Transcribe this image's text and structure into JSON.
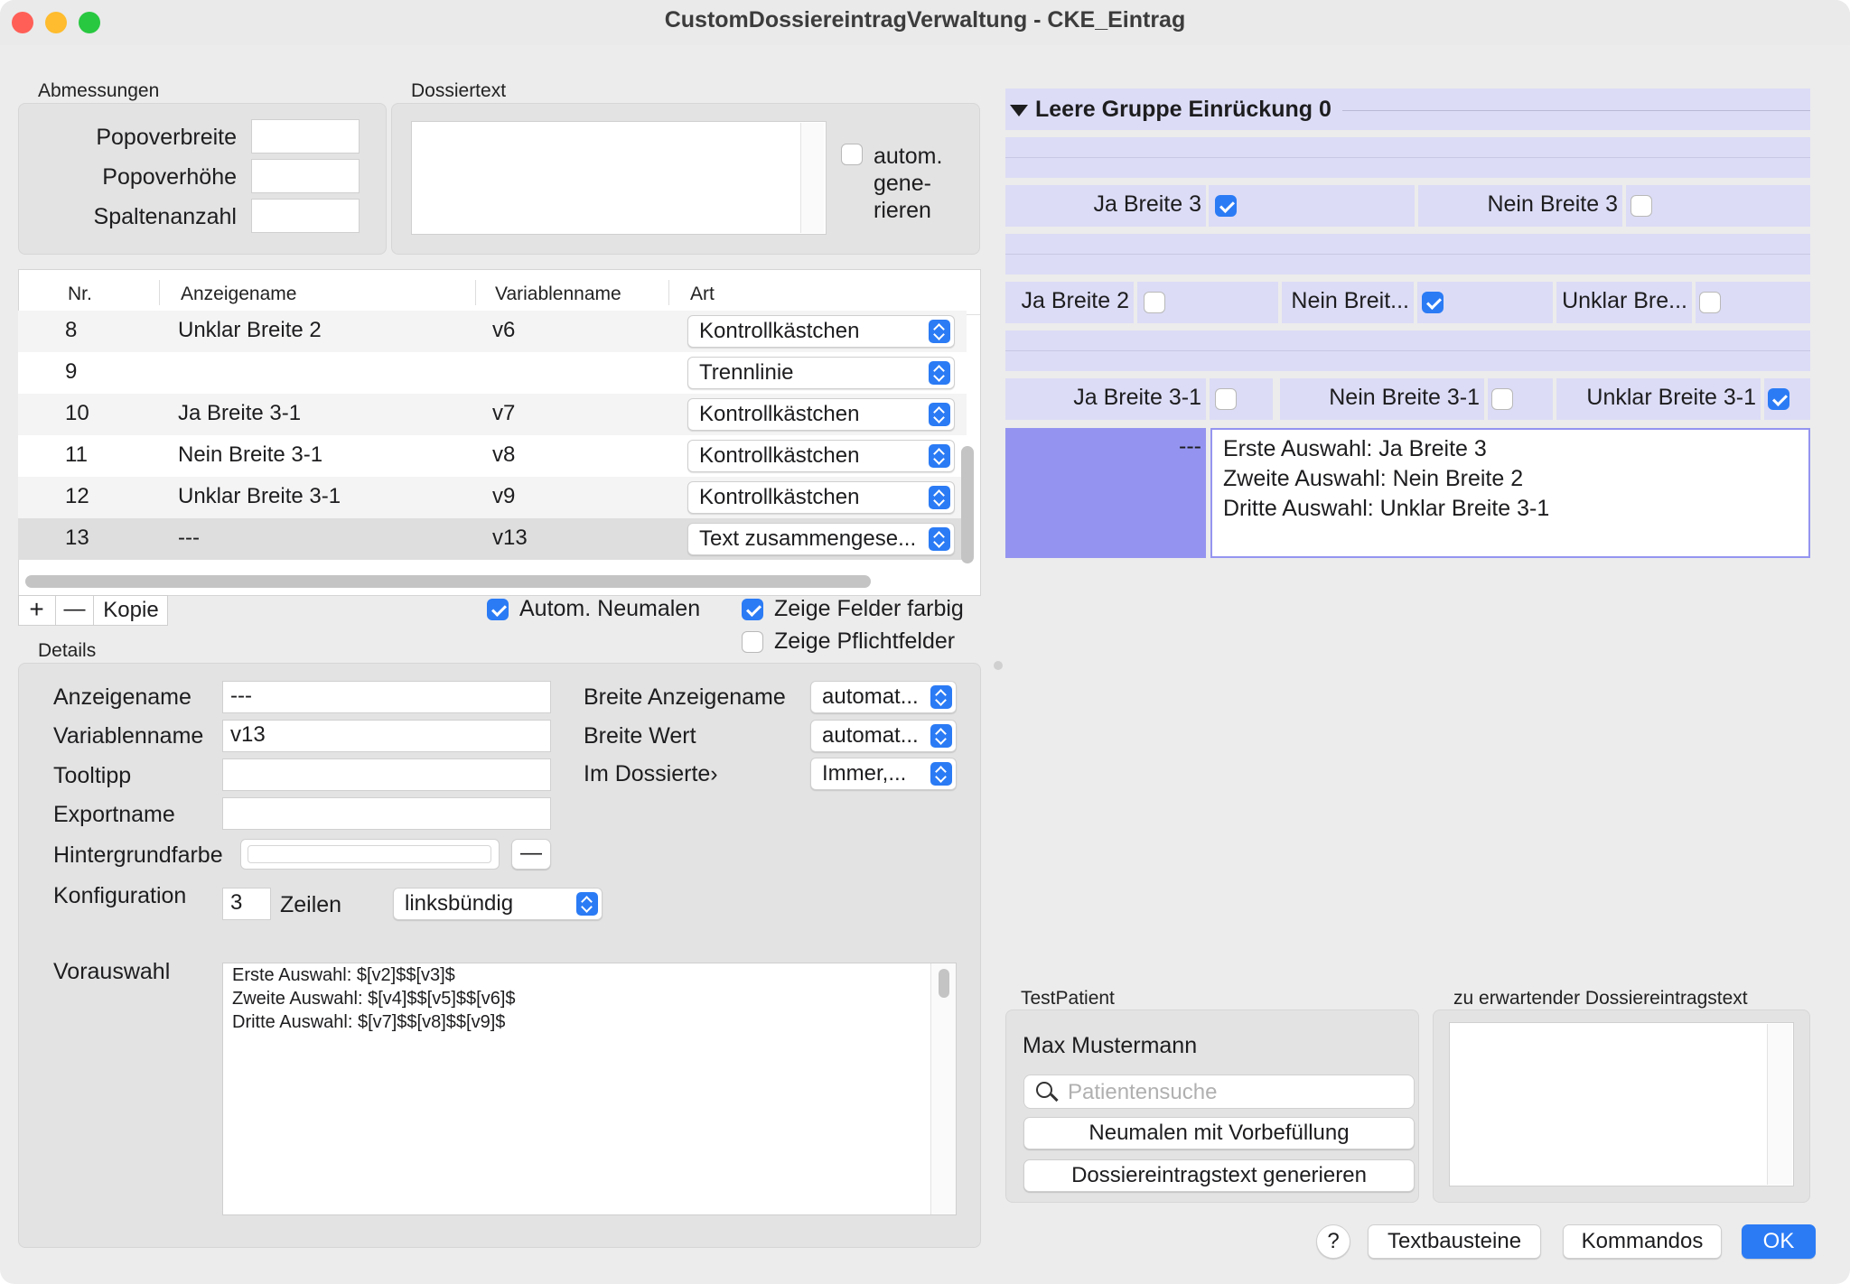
{
  "window": {
    "title": "CustomDossiereintragVerwaltung - CKE_Eintrag"
  },
  "abmessungen": {
    "title": "Abmessungen",
    "popoverbreite": "Popoverbreite",
    "popoverhoehe": "Popoverhöhe",
    "spaltenanzahl": "Spaltenanzahl"
  },
  "dossiertext": {
    "title": "Dossiertext",
    "auto_line1": "autom.",
    "auto_line2": "gene-",
    "auto_line3": "rieren"
  },
  "table": {
    "headers": {
      "nr": "Nr.",
      "anzeigename": "Anzeigename",
      "variablenname": "Variablenname",
      "art": "Art"
    },
    "rows": [
      {
        "nr": "8",
        "name": "Unklar Breite 2",
        "var": "v6",
        "art": "Kontrollkästchen"
      },
      {
        "nr": "9",
        "name": "",
        "var": "",
        "art": "Trennlinie"
      },
      {
        "nr": "10",
        "name": "Ja Breite 3-1",
        "var": "v7",
        "art": "Kontrollkästchen"
      },
      {
        "nr": "11",
        "name": "Nein Breite 3-1",
        "var": "v8",
        "art": "Kontrollkästchen"
      },
      {
        "nr": "12",
        "name": "Unklar Breite 3-1",
        "var": "v9",
        "art": "Kontrollkästchen"
      },
      {
        "nr": "13",
        "name": "---",
        "var": "v13",
        "art": "Text zusammengese..."
      }
    ]
  },
  "toolbar": {
    "add": "+",
    "remove": "—",
    "copy": "Kopie",
    "auto_neumalen": "Autom. Neumalen",
    "zeige_farbig": "Zeige Felder farbig",
    "zeige_pflicht": "Zeige Pflichtfelder"
  },
  "details": {
    "title": "Details",
    "anzeigename_label": "Anzeigename",
    "anzeigename_value": "---",
    "variablenname_label": "Variablenname",
    "variablenname_value": "v13",
    "tooltipp_label": "Tooltipp",
    "exportname_label": "Exportname",
    "hintergrund_label": "Hintergrundfarbe",
    "hintergrund_btn": "—",
    "konfig_label": "Konfiguration",
    "konfig_value": "3",
    "zeilen_label": "Zeilen",
    "align_value": "linksbündig",
    "vorauswahl_label": "Vorauswahl",
    "vorauswahl_value": "Erste Auswahl: $[v2]$$[v3]$\nZweite Auswahl: $[v4]$$[v5]$$[v6]$\nDritte Auswahl: $[v7]$$[v8]$$[v9]$",
    "breite_anzeige_label": "Breite Anzeigename",
    "breite_anzeige_value": "automat...",
    "breite_wert_label": "Breite Wert",
    "breite_wert_value": "automat...",
    "im_dossier_label": "Im Dossierte›",
    "im_dossier_value": "Immer,..."
  },
  "preview": {
    "group_title": "Leere Gruppe Einrückung 0",
    "ja3": "Ja Breite 3",
    "nein3": "Nein Breite 3",
    "ja2": "Ja Breite 2",
    "nein2": "Nein Breit...",
    "unklar2": "Unklar Bre...",
    "ja31": "Ja Breite 3-1",
    "nein31": "Nein Breite 3-1",
    "unklar31": "Unklar Breite 3-1",
    "text_label": "---",
    "text_value": "Erste Auswahl: Ja Breite 3\nZweite Auswahl: Nein Breite 2\nDritte Auswahl: Unklar Breite 3-1"
  },
  "testpatient": {
    "title": "TestPatient",
    "name": "Max Mustermann",
    "search_placeholder": "Patientensuche",
    "neumalen_btn": "Neumalen mit Vorbefüllung",
    "generieren_btn": "Dossiereintragstext generieren"
  },
  "erwartet": {
    "title": "zu erwartender Dossiereintragstext"
  },
  "footer": {
    "help": "?",
    "textbausteine": "Textbausteine",
    "kommandos": "Kommandos",
    "ok": "OK"
  }
}
